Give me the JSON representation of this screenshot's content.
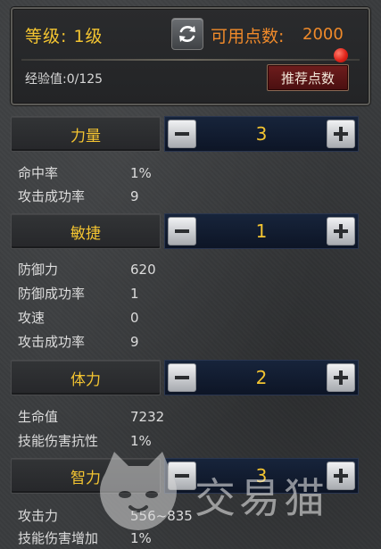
{
  "header": {
    "level": "等级: 1级",
    "points_label": "可用点数:",
    "points_value": "2000",
    "exp": "经验值:0/125",
    "recommend_label": "推荐点数",
    "icons": {
      "refresh": "refresh-icon",
      "notification": "notification-dot"
    }
  },
  "stats": [
    {
      "name": "力量",
      "value": "3",
      "details": [
        {
          "label": "命中率",
          "value": "1%"
        },
        {
          "label": "攻击成功率",
          "value": "9"
        }
      ]
    },
    {
      "name": "敏捷",
      "value": "1",
      "details": [
        {
          "label": "防御力",
          "value": "620"
        },
        {
          "label": "防御成功率",
          "value": "1"
        },
        {
          "label": "攻速",
          "value": "0"
        },
        {
          "label": "攻击成功率",
          "value": "9"
        }
      ]
    },
    {
      "name": "体力",
      "value": "2",
      "details": [
        {
          "label": "生命值",
          "value": "7232"
        },
        {
          "label": "技能伤害抗性",
          "value": "1%"
        }
      ]
    },
    {
      "name": "智力",
      "value": "3",
      "details": [
        {
          "label": "攻击力",
          "value": "556~835"
        },
        {
          "label": "技能伤害增加",
          "value": "1%"
        }
      ]
    }
  ],
  "watermark": {
    "text": "交易猫",
    "icon": "cat-logo-icon"
  },
  "colors": {
    "gold": "#f3c431",
    "orange": "#f08a2a",
    "panel": "#17243b"
  }
}
